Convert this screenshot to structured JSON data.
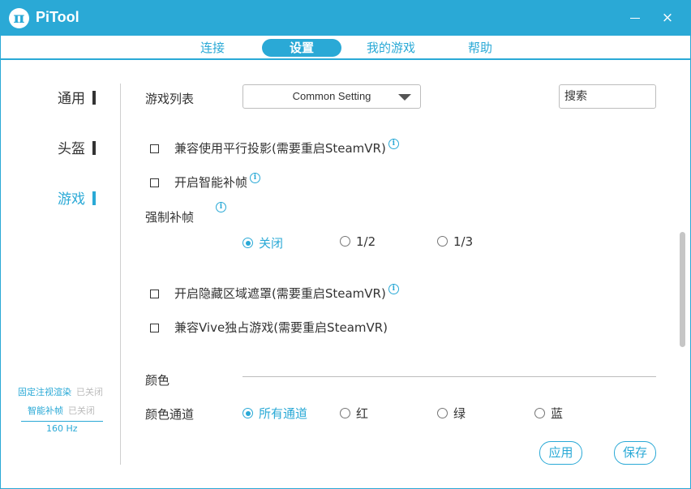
{
  "window": {
    "title": "PiTool",
    "logo_glyph": "π",
    "minimize_icon": "minimize-icon",
    "close_glyph": "×",
    "accent_color": "#2aa9d6"
  },
  "tabs": [
    {
      "label": "连接",
      "active": false
    },
    {
      "label": "设置",
      "active": true
    },
    {
      "label": "我的游戏",
      "active": false
    },
    {
      "label": "帮助",
      "active": false
    }
  ],
  "sidebar": {
    "items": [
      {
        "label": "通用",
        "active": false
      },
      {
        "label": "头盔",
        "active": false
      },
      {
        "label": "游戏",
        "active": true
      }
    ],
    "status": [
      {
        "label": "固定注视渲染",
        "value": "已关闭"
      },
      {
        "label": "智能补帧",
        "value": "已关闭"
      }
    ],
    "refresh_rate": "160 Hz"
  },
  "game_list": {
    "label": "游戏列表",
    "selected": "Common Setting",
    "search_placeholder": "搜索"
  },
  "options": {
    "parallel_projection": {
      "label": "兼容使用平行投影(需要重启SteamVR)",
      "checked": false
    },
    "smart_smoothing": {
      "label": "开启智能补帧",
      "checked": false
    },
    "forced_smoothing": {
      "label": "强制补帧",
      "choices": [
        {
          "label": "关闭",
          "checked": true
        },
        {
          "label": "1/2",
          "checked": false
        },
        {
          "label": "1/3",
          "checked": false
        }
      ]
    },
    "hidden_area_mask": {
      "label": "开启隐藏区域遮罩(需要重启SteamVR)",
      "checked": false
    },
    "vive_exclusive": {
      "label": "兼容Vive独占游戏(需要重启SteamVR)",
      "checked": false
    }
  },
  "color": {
    "section_label": "颜色",
    "channel_label": "颜色通道",
    "channels": [
      {
        "label": "所有通道",
        "checked": true
      },
      {
        "label": "红",
        "checked": false
      },
      {
        "label": "绿",
        "checked": false
      },
      {
        "label": "蓝",
        "checked": false
      }
    ]
  },
  "info_glyph": "i",
  "buttons": {
    "apply": "应用",
    "save": "保存"
  }
}
